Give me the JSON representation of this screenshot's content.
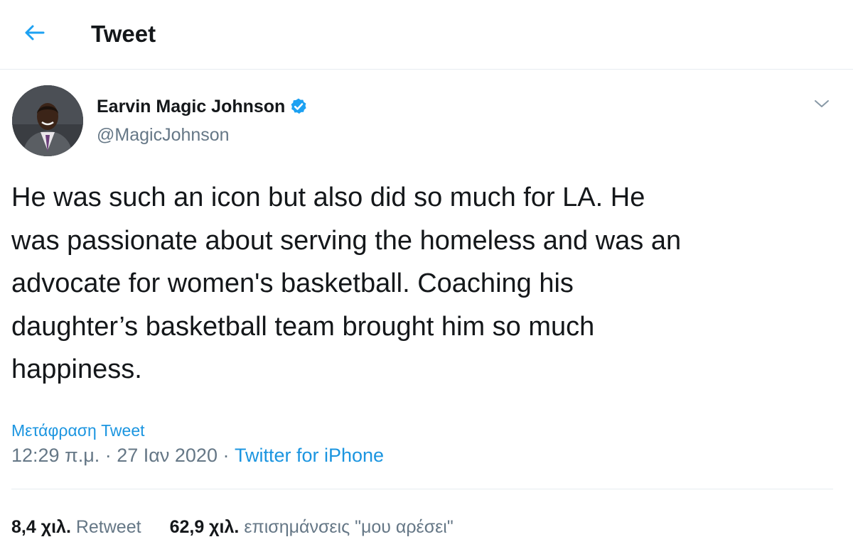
{
  "header": {
    "title": "Tweet",
    "back_icon": "arrow-left-icon"
  },
  "tweet": {
    "author": {
      "name": "Earvin Magic Johnson",
      "handle": "@MagicJohnson",
      "verified": true,
      "verified_icon": "verified-badge-icon"
    },
    "text": "He was such an icon but also did so much for LA. He\nwas passionate about serving the homeless and was an\nadvocate for women's basketball. Coaching his\ndaughter’s basketball team brought him so much\nhappiness.",
    "translate_label": "Μετάφραση Tweet",
    "timestamp": "12:29 π.μ. · 27 Ιαν 2020",
    "separator": " · ",
    "source": "Twitter for iPhone",
    "stats": {
      "retweets_count": "8,4 χιλ.",
      "retweets_label": "Retweet",
      "likes_count": "62,9 χιλ.",
      "likes_label": "επισημάνσεις \"μου αρέσει\""
    }
  },
  "colors": {
    "accent": "#1da1f2",
    "link": "#1b95e0",
    "secondary_text": "#657786",
    "primary_text": "#14171a",
    "border": "#e6ecf0"
  }
}
